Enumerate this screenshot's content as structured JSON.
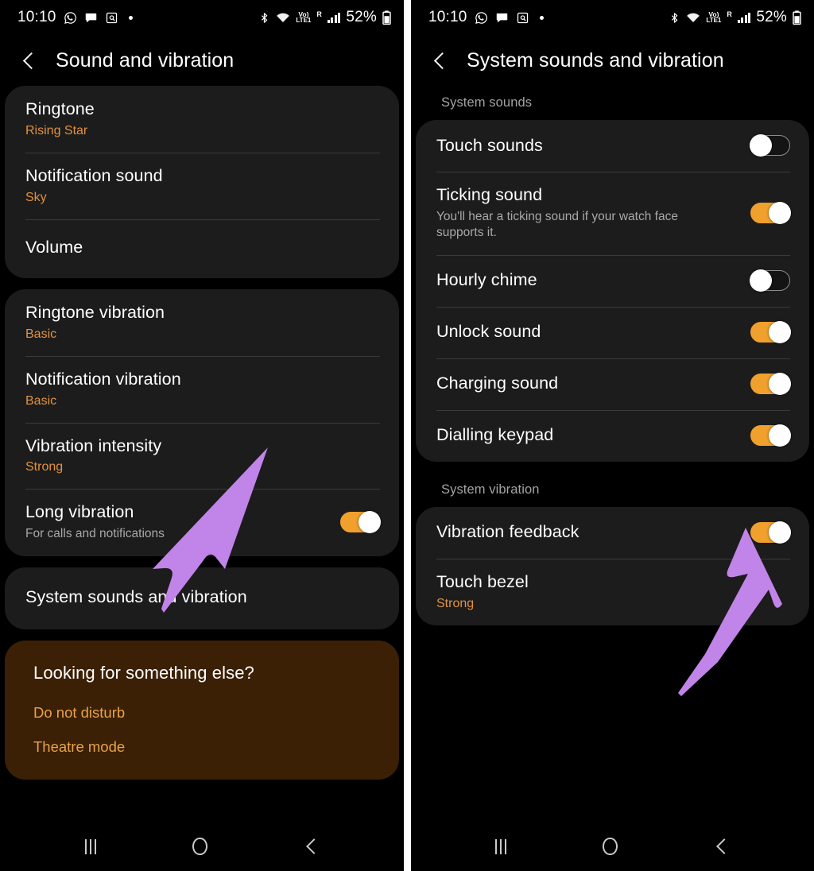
{
  "status_bar": {
    "time": "10:10",
    "battery_percent": "52%",
    "network_voice": "Vo)",
    "network_type": "LTE1",
    "roaming": "R",
    "icons": [
      "whatsapp-icon",
      "message-icon",
      "document-search-icon",
      "dot-icon",
      "bluetooth-icon",
      "wifi-icon",
      "volte-icon",
      "signal-icon",
      "battery-icon"
    ]
  },
  "left_screen": {
    "title": "Sound and vibration",
    "sound_card": [
      {
        "title": "Ringtone",
        "sub": "Rising Star"
      },
      {
        "title": "Notification sound",
        "sub": "Sky"
      },
      {
        "title": "Volume",
        "sub": ""
      }
    ],
    "vibration_card": [
      {
        "title": "Ringtone vibration",
        "sub": "Basic"
      },
      {
        "title": "Notification vibration",
        "sub": "Basic"
      },
      {
        "title": "Vibration intensity",
        "sub": "Strong"
      },
      {
        "title": "Long vibration",
        "desc": "For calls and notifications",
        "toggle": "on"
      }
    ],
    "nav_item": {
      "title": "System sounds and vibration"
    },
    "promo": {
      "title": "Looking for something else?",
      "links": [
        "Do not disturb",
        "Theatre mode"
      ]
    }
  },
  "right_screen": {
    "title": "System sounds and vibration",
    "section_sounds": "System sounds",
    "sounds_card": [
      {
        "title": "Touch sounds",
        "desc": "",
        "toggle": "off"
      },
      {
        "title": "Ticking sound",
        "desc": "You'll hear a ticking sound if your watch face supports it.",
        "toggle": "on"
      },
      {
        "title": "Hourly chime",
        "desc": "",
        "toggle": "off"
      },
      {
        "title": "Unlock sound",
        "desc": "",
        "toggle": "on"
      },
      {
        "title": "Charging sound",
        "desc": "",
        "toggle": "on"
      },
      {
        "title": "Dialling keypad",
        "desc": "",
        "toggle": "on"
      }
    ],
    "section_vibration": "System vibration",
    "vibration_card": [
      {
        "title": "Vibration feedback",
        "sub": "",
        "toggle": "on"
      },
      {
        "title": "Touch bezel",
        "sub": "Strong",
        "toggle": "none"
      }
    ]
  },
  "nav_bar": {
    "recents_label": "recents-button",
    "home_label": "home-button",
    "back_label": "back-button"
  },
  "colors": {
    "accent_orange": "#e3913f",
    "toggle_on": "#f0a02c",
    "promo_background": "#3b2005",
    "card_background": "#1c1c1c",
    "annotation_arrow": "#c184e8"
  }
}
